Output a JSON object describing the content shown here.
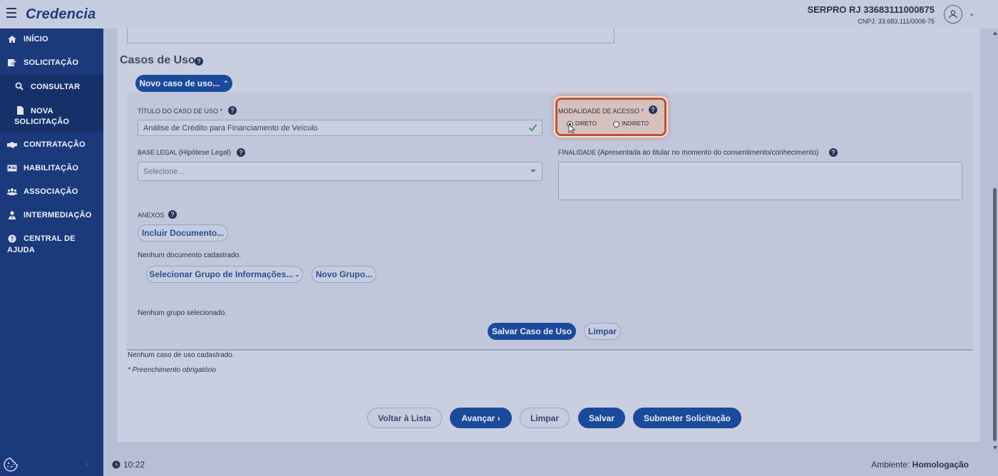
{
  "header": {
    "brand": "Credencia",
    "org_name": "SERPRO RJ 33683111000875",
    "org_cnpj": "CNPJ: 33.683.111/0008-75"
  },
  "sidebar": {
    "items": [
      {
        "label": "INÍCIO",
        "icon": "home-icon"
      },
      {
        "label": "SOLICITAÇÃO",
        "icon": "edit-icon"
      },
      {
        "label": "CONSULTAR",
        "icon": "search-icon"
      },
      {
        "label_line1": "NOVA",
        "label_line2": "SOLICITAÇÃO",
        "icon": "document-icon"
      },
      {
        "label": "CONTRATAÇÃO",
        "icon": "handshake-icon"
      },
      {
        "label": "HABILITAÇÃO",
        "icon": "id-card-icon"
      },
      {
        "label": "ASSOCIAÇÃO",
        "icon": "users-icon"
      },
      {
        "label": "INTERMEDIAÇÃO",
        "icon": "user-tie-icon"
      },
      {
        "label_line1": "CENTRAL DE",
        "label_line2": "AJUDA",
        "icon": "help-circle-icon"
      }
    ],
    "collapse_label": "‹"
  },
  "casos_uso": {
    "section_title": "Casos de Uso",
    "new_case_button": "Novo caso de uso...",
    "titulo_label": "TÍTULO DO CASO DE USO *",
    "titulo_value": "Análise de Crédito para Financiamento de Veículo",
    "modalidade_label": "MODALIDADE DE ACESSO *",
    "modalidade_options": [
      "DIRETO",
      "INDIRETO"
    ],
    "modalidade_selected": "DIRETO",
    "base_legal_label": "BASE LEGAL",
    "base_legal_hint": "(Hipótese Legal)",
    "base_legal_placeholder": "Selecione...",
    "finalidade_label": "FINALIDADE",
    "finalidade_hint": "(Apresentada ao titular no momento do consentimento/conhecimento)",
    "anexos_label": "ANEXOS",
    "incluir_doc_button": "Incluir Documento...",
    "no_docs_text": "Nenhum documento cadastrado.",
    "select_group_button": "Selecionar Grupo de Informações...",
    "new_group_button": "Novo Grupo...",
    "no_group_text": "Nenhum grupo selecionado.",
    "save_case_button": "Salvar Caso de Uso",
    "clear_case_button": "Limpar",
    "no_case_text": "Nenhum caso de uso cadastrado.",
    "required_note": "* Preenchimento obrigatório"
  },
  "actions": {
    "back": "Voltar à Lista",
    "next": "Avançar ›",
    "clear": "Limpar",
    "save": "Salvar",
    "submit": "Submeter Solicitação"
  },
  "footer": {
    "time": "10:22",
    "env_label": "Ambiente:",
    "env_value": "Homologação"
  },
  "colors": {
    "sidebar": "#1b3a7c",
    "primary": "#1c4a9a",
    "highlight": "#c0532a"
  }
}
